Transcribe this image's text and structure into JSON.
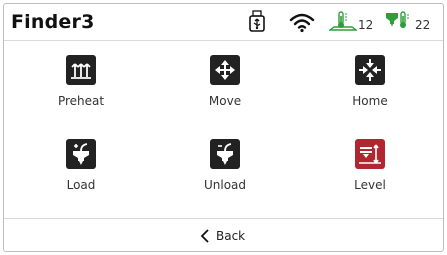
{
  "header": {
    "title": "Finder3",
    "bed_temp": "12",
    "nozzle_temp": "22",
    "icons": {
      "usb": "usb-icon",
      "wifi": "wifi-icon",
      "bed": "bed-temperature-icon",
      "nozzle": "nozzle-temperature-icon"
    }
  },
  "menu": {
    "preheat": {
      "label": "Preheat",
      "icon": "preheat-icon"
    },
    "move": {
      "label": "Move",
      "icon": "move-icon"
    },
    "home": {
      "label": "Home",
      "icon": "home-icon"
    },
    "load": {
      "label": "Load",
      "icon": "load-filament-icon"
    },
    "unload": {
      "label": "Unload",
      "icon": "unload-filament-icon"
    },
    "level": {
      "label": "Level",
      "icon": "level-icon"
    }
  },
  "footer": {
    "back_label": "Back"
  },
  "colors": {
    "tile": "#222222",
    "level_tile": "#b02732",
    "temp_green": "#2e9e3a"
  }
}
